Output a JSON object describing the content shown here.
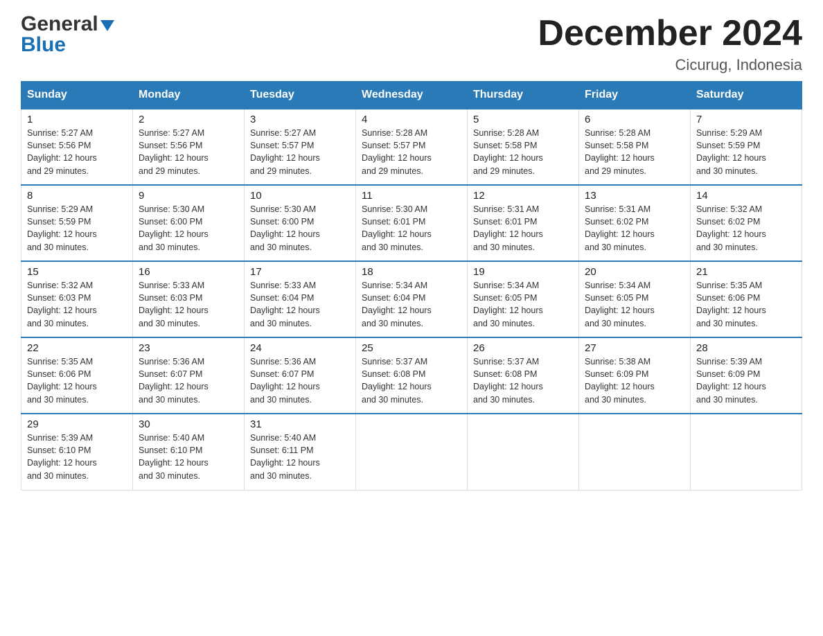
{
  "header": {
    "logo_general": "General",
    "logo_triangle": "▶",
    "logo_blue": "Blue",
    "main_title": "December 2024",
    "subtitle": "Cicurug, Indonesia"
  },
  "calendar": {
    "days_of_week": [
      "Sunday",
      "Monday",
      "Tuesday",
      "Wednesday",
      "Thursday",
      "Friday",
      "Saturday"
    ],
    "weeks": [
      [
        {
          "day": "1",
          "sunrise": "5:27 AM",
          "sunset": "5:56 PM",
          "daylight": "12 hours and 29 minutes."
        },
        {
          "day": "2",
          "sunrise": "5:27 AM",
          "sunset": "5:56 PM",
          "daylight": "12 hours and 29 minutes."
        },
        {
          "day": "3",
          "sunrise": "5:27 AM",
          "sunset": "5:57 PM",
          "daylight": "12 hours and 29 minutes."
        },
        {
          "day": "4",
          "sunrise": "5:28 AM",
          "sunset": "5:57 PM",
          "daylight": "12 hours and 29 minutes."
        },
        {
          "day": "5",
          "sunrise": "5:28 AM",
          "sunset": "5:58 PM",
          "daylight": "12 hours and 29 minutes."
        },
        {
          "day": "6",
          "sunrise": "5:28 AM",
          "sunset": "5:58 PM",
          "daylight": "12 hours and 29 minutes."
        },
        {
          "day": "7",
          "sunrise": "5:29 AM",
          "sunset": "5:59 PM",
          "daylight": "12 hours and 30 minutes."
        }
      ],
      [
        {
          "day": "8",
          "sunrise": "5:29 AM",
          "sunset": "5:59 PM",
          "daylight": "12 hours and 30 minutes."
        },
        {
          "day": "9",
          "sunrise": "5:30 AM",
          "sunset": "6:00 PM",
          "daylight": "12 hours and 30 minutes."
        },
        {
          "day": "10",
          "sunrise": "5:30 AM",
          "sunset": "6:00 PM",
          "daylight": "12 hours and 30 minutes."
        },
        {
          "day": "11",
          "sunrise": "5:30 AM",
          "sunset": "6:01 PM",
          "daylight": "12 hours and 30 minutes."
        },
        {
          "day": "12",
          "sunrise": "5:31 AM",
          "sunset": "6:01 PM",
          "daylight": "12 hours and 30 minutes."
        },
        {
          "day": "13",
          "sunrise": "5:31 AM",
          "sunset": "6:02 PM",
          "daylight": "12 hours and 30 minutes."
        },
        {
          "day": "14",
          "sunrise": "5:32 AM",
          "sunset": "6:02 PM",
          "daylight": "12 hours and 30 minutes."
        }
      ],
      [
        {
          "day": "15",
          "sunrise": "5:32 AM",
          "sunset": "6:03 PM",
          "daylight": "12 hours and 30 minutes."
        },
        {
          "day": "16",
          "sunrise": "5:33 AM",
          "sunset": "6:03 PM",
          "daylight": "12 hours and 30 minutes."
        },
        {
          "day": "17",
          "sunrise": "5:33 AM",
          "sunset": "6:04 PM",
          "daylight": "12 hours and 30 minutes."
        },
        {
          "day": "18",
          "sunrise": "5:34 AM",
          "sunset": "6:04 PM",
          "daylight": "12 hours and 30 minutes."
        },
        {
          "day": "19",
          "sunrise": "5:34 AM",
          "sunset": "6:05 PM",
          "daylight": "12 hours and 30 minutes."
        },
        {
          "day": "20",
          "sunrise": "5:34 AM",
          "sunset": "6:05 PM",
          "daylight": "12 hours and 30 minutes."
        },
        {
          "day": "21",
          "sunrise": "5:35 AM",
          "sunset": "6:06 PM",
          "daylight": "12 hours and 30 minutes."
        }
      ],
      [
        {
          "day": "22",
          "sunrise": "5:35 AM",
          "sunset": "6:06 PM",
          "daylight": "12 hours and 30 minutes."
        },
        {
          "day": "23",
          "sunrise": "5:36 AM",
          "sunset": "6:07 PM",
          "daylight": "12 hours and 30 minutes."
        },
        {
          "day": "24",
          "sunrise": "5:36 AM",
          "sunset": "6:07 PM",
          "daylight": "12 hours and 30 minutes."
        },
        {
          "day": "25",
          "sunrise": "5:37 AM",
          "sunset": "6:08 PM",
          "daylight": "12 hours and 30 minutes."
        },
        {
          "day": "26",
          "sunrise": "5:37 AM",
          "sunset": "6:08 PM",
          "daylight": "12 hours and 30 minutes."
        },
        {
          "day": "27",
          "sunrise": "5:38 AM",
          "sunset": "6:09 PM",
          "daylight": "12 hours and 30 minutes."
        },
        {
          "day": "28",
          "sunrise": "5:39 AM",
          "sunset": "6:09 PM",
          "daylight": "12 hours and 30 minutes."
        }
      ],
      [
        {
          "day": "29",
          "sunrise": "5:39 AM",
          "sunset": "6:10 PM",
          "daylight": "12 hours and 30 minutes."
        },
        {
          "day": "30",
          "sunrise": "5:40 AM",
          "sunset": "6:10 PM",
          "daylight": "12 hours and 30 minutes."
        },
        {
          "day": "31",
          "sunrise": "5:40 AM",
          "sunset": "6:11 PM",
          "daylight": "12 hours and 30 minutes."
        },
        null,
        null,
        null,
        null
      ]
    ],
    "sunrise_label": "Sunrise:",
    "sunset_label": "Sunset:",
    "daylight_label": "Daylight:"
  }
}
